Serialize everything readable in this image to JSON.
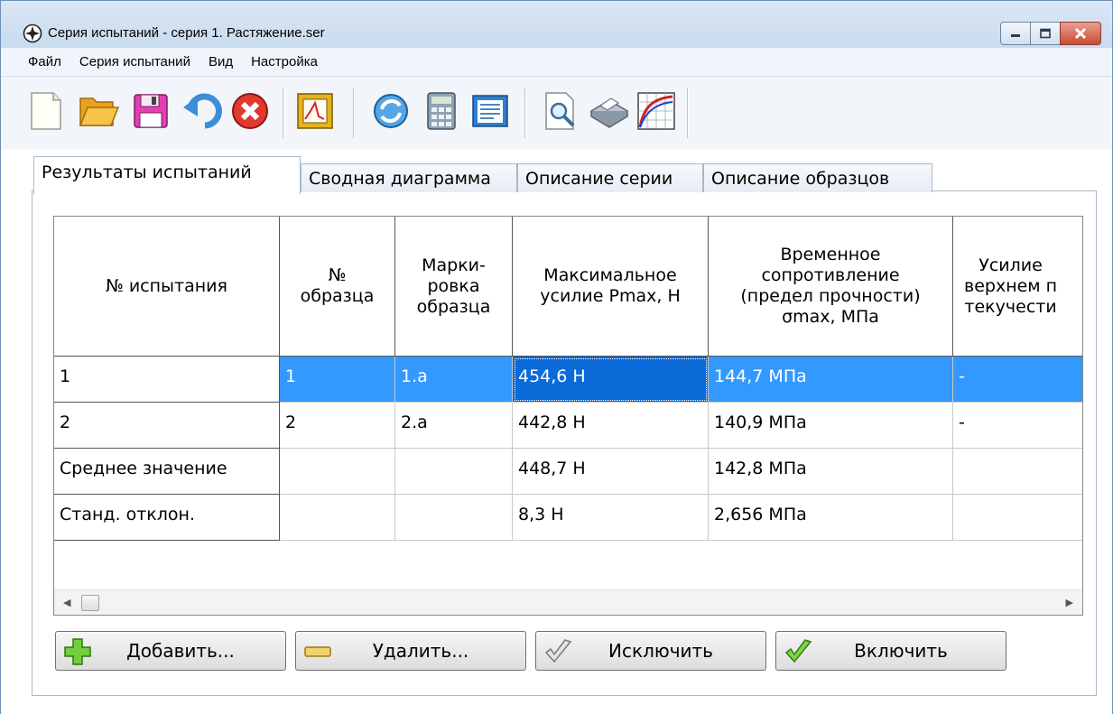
{
  "window": {
    "title": "Серия испытаний - серия 1. Растяжение.ser"
  },
  "menu": [
    "Файл",
    "Серия испытаний",
    "Вид",
    "Настройка"
  ],
  "toolbar": {
    "icons": [
      "new-icon",
      "open-folder-icon",
      "save-icon",
      "undo-icon",
      "close-circle-icon",
      "chart-frame-icon",
      "refresh-icon",
      "calculator-icon",
      "report-icon",
      "preview-icon",
      "print-icon",
      "curve-chart-icon"
    ]
  },
  "tabs": [
    "Результаты испытаний",
    "Сводная диаграмма",
    "Описание серии",
    "Описание образцов"
  ],
  "table": {
    "headers": [
      "№ испытания",
      "№\nобразца",
      "Марки-\nровка\nобразца",
      "Максимальное\nусилие Pmax, Н",
      "Временное\nсопротивление\n(предел прочности)\nσmax, МПа",
      "Усилие\nверхнем п\nтекучести"
    ],
    "rows": [
      {
        "label": "1",
        "cells": [
          "1",
          "1.a",
          "454,6 Н",
          "144,7 МПа",
          "-"
        ]
      },
      {
        "label": "2",
        "cells": [
          "2",
          "2.a",
          "442,8 Н",
          "140,9 МПа",
          "-"
        ]
      },
      {
        "label": "Среднее значение",
        "cells": [
          "",
          "",
          "448,7 Н",
          "142,8 МПа",
          ""
        ]
      },
      {
        "label": "Станд. отклон.",
        "cells": [
          "",
          "",
          "8,3 Н",
          "2,656 МПа",
          ""
        ]
      }
    ],
    "selected_row": 0
  },
  "buttons": {
    "add": "Добавить...",
    "delete": "Удалить...",
    "exclude": "Исключить",
    "include": "Включить"
  },
  "colors": {
    "selection": "#3399ff",
    "focus": "#0a6ad8"
  }
}
